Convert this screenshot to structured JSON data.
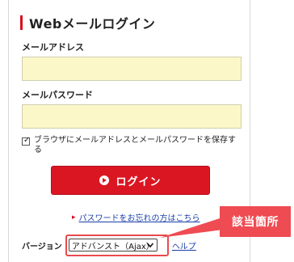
{
  "login": {
    "title": "Webメールログイン",
    "email_label": "メールアドレス",
    "email_value": "",
    "password_label": "メールパスワード",
    "password_value": "",
    "remember_checked": true,
    "remember_text": "ブラウザにメールアドレスとメールパスワードを保存する",
    "login_button": "ログイン",
    "forgot_link": "パスワードをお忘れの方はこちら",
    "version_label": "バージョン",
    "version_selected": "アドバンスト（Ajax）",
    "help_link": "ヘルプ"
  },
  "annotation": {
    "callout_text": "該当箇所"
  },
  "colors": {
    "accent_red": "#d6101f",
    "input_bg": "#fbf7c9",
    "link_blue": "#1a3fa8",
    "callout_red": "#ef4b52"
  }
}
